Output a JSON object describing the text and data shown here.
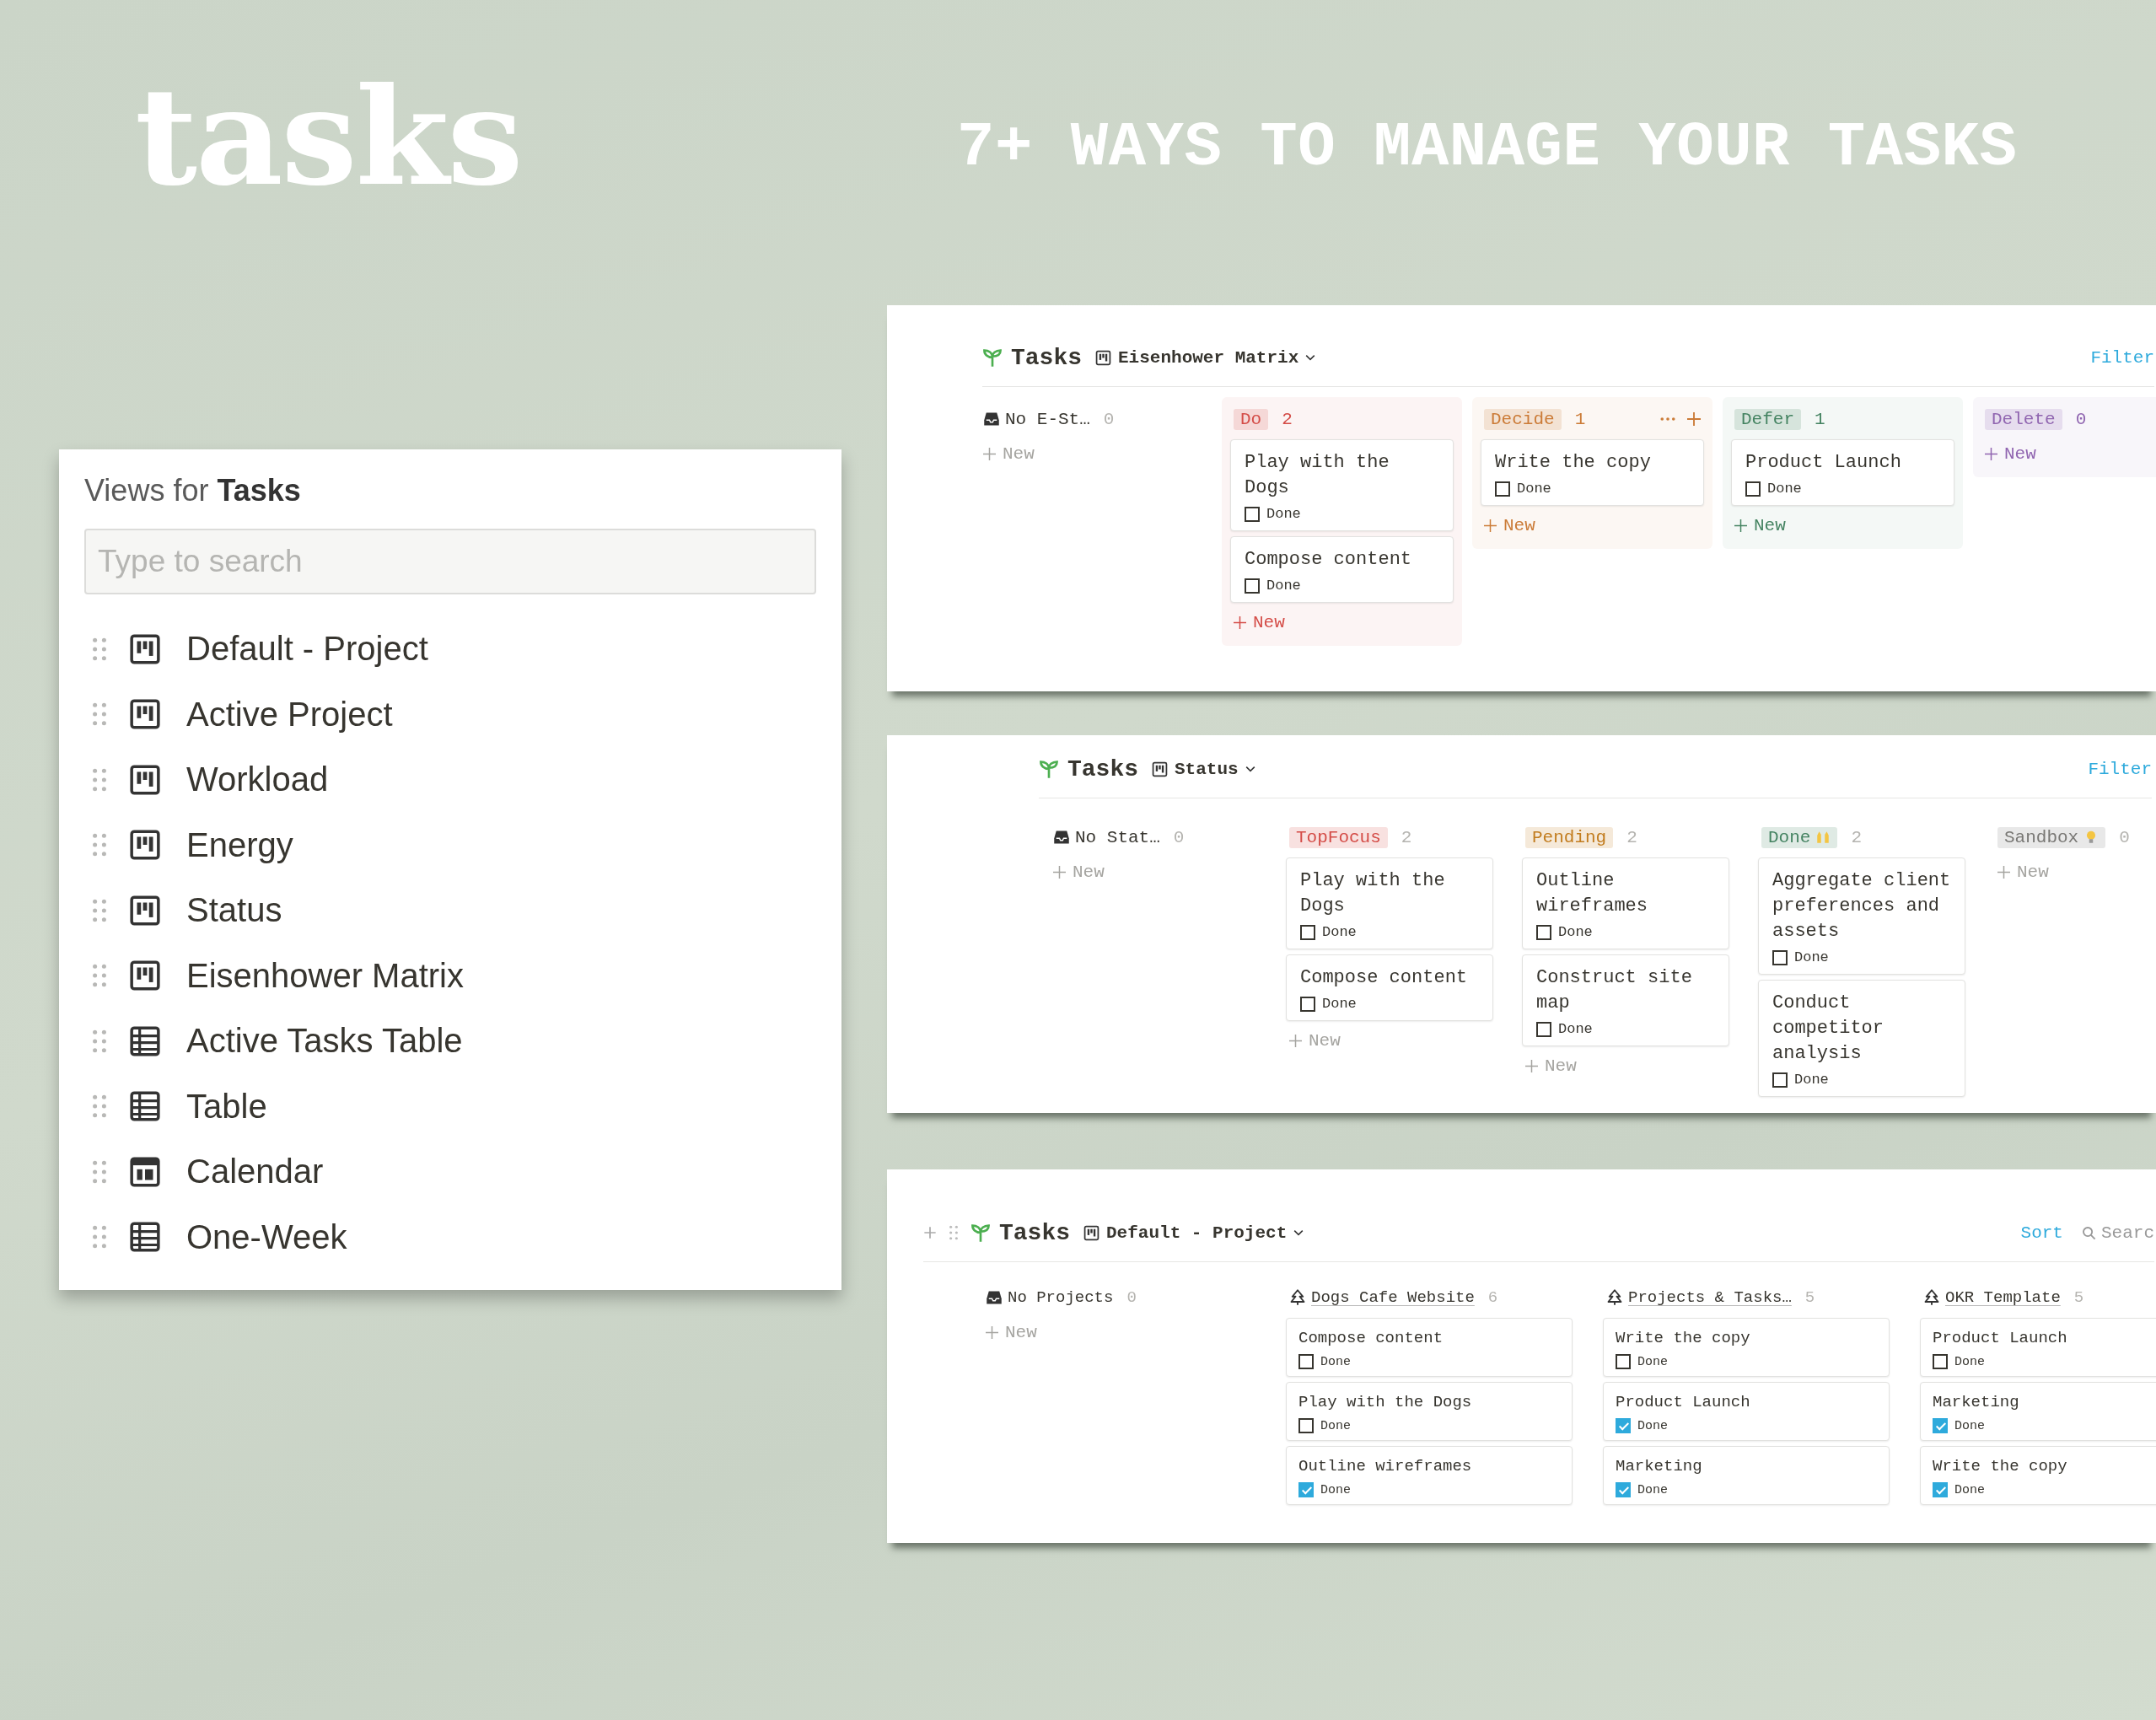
{
  "hero": {
    "title": "tasks",
    "tagline": "7+ WAYS TO MANAGE YOUR TASKS"
  },
  "views_panel": {
    "title": "Views for **Tasks**",
    "search": {
      "placeholder": "Type to search"
    },
    "items": [
      {
        "label": "Default - Project",
        "kind": "board"
      },
      {
        "label": "Active Project",
        "kind": "board"
      },
      {
        "label": "Workload",
        "kind": "board"
      },
      {
        "label": "Energy",
        "kind": "board"
      },
      {
        "label": "Status",
        "kind": "board"
      },
      {
        "label": "Eisenhower Matrix",
        "kind": "board"
      },
      {
        "label": "Active Tasks Table",
        "kind": "table"
      },
      {
        "label": "Table",
        "kind": "table"
      },
      {
        "label": "Calendar",
        "kind": "calendar"
      },
      {
        "label": "One-Week",
        "kind": "table"
      }
    ]
  },
  "boards": [
    {
      "database": "Tasks",
      "view": "Eisenhower Matrix",
      "tinted": true,
      "row_handles": false,
      "actions": [
        {
          "label": "Filter",
          "kind": "link"
        }
      ],
      "columns": [
        {
          "kind": "none",
          "name": "No E-St…",
          "count": "0",
          "new_label": "New"
        },
        {
          "kind": "tag",
          "name": "Do",
          "color": "#d44c47",
          "count": "2",
          "new_label": "New",
          "cards": [
            {
              "title": "Play with the Dogs",
              "field": "Done",
              "checked": false
            },
            {
              "title": "Compose content",
              "field": "Done",
              "checked": false
            }
          ]
        },
        {
          "kind": "tag",
          "name": "Decide",
          "color": "#cb7b37",
          "count": "1",
          "hover_actions": true,
          "new_label": "New",
          "cards": [
            {
              "title": "Write the copy",
              "field": "Done",
              "checked": false
            }
          ]
        },
        {
          "kind": "tag",
          "name": "Defer",
          "color": "#448361",
          "count": "1",
          "new_label": "New",
          "cards": [
            {
              "title": "Product Launch",
              "field": "Done",
              "checked": false
            }
          ]
        },
        {
          "kind": "tag",
          "name": "Delete",
          "color": "#9065b0",
          "count": "0",
          "new_label": "New"
        }
      ]
    },
    {
      "database": "Tasks",
      "view": "Status",
      "tinted": false,
      "row_handles": false,
      "actions": [
        {
          "label": "Filter",
          "kind": "link"
        }
      ],
      "columns": [
        {
          "kind": "none",
          "name": "No Stat…",
          "count": "0",
          "new_label": "New"
        },
        {
          "kind": "tag",
          "name": "TopFocus",
          "color": "#d44c47",
          "count": "2",
          "new_label": "New",
          "cards": [
            {
              "title": "Play with the Dogs",
              "field": "Done",
              "checked": false
            },
            {
              "title": "Compose content",
              "field": "Done",
              "checked": false
            }
          ]
        },
        {
          "kind": "tag",
          "name": "Pending",
          "color": "#c27c1e",
          "count": "2",
          "new_label": "New",
          "cards": [
            {
              "title": "Outline wireframes",
              "field": "Done",
              "checked": false
            },
            {
              "title": "Construct site map",
              "field": "Done",
              "checked": false
            }
          ]
        },
        {
          "kind": "tag",
          "name": "Done",
          "color": "#448361",
          "hands_icon": true,
          "count": "2",
          "cards": [
            {
              "title": "Aggregate client preferences and assets",
              "field": "Done",
              "checked": false
            },
            {
              "title": "Conduct competitor analysis",
              "field": "Done",
              "checked": false
            }
          ]
        },
        {
          "kind": "tag",
          "name": "Sandbox",
          "color": "#787774",
          "bulb_icon": true,
          "count": "0",
          "new_label": "New"
        }
      ]
    },
    {
      "database": "Tasks",
      "view": "Default - Project",
      "tinted": false,
      "row_handles": true,
      "actions": [
        {
          "label": "Sort",
          "kind": "link"
        },
        {
          "label": "Searc",
          "kind": "search"
        }
      ],
      "columns": [
        {
          "kind": "none",
          "name": "No Projects",
          "count": "0",
          "new_label": "New"
        },
        {
          "kind": "project",
          "name": "Dogs Cafe Website",
          "count": "6",
          "cards": [
            {
              "title": "Compose content",
              "field": "Done",
              "checked": false
            },
            {
              "title": "Play with the Dogs",
              "field": "Done",
              "checked": false
            },
            {
              "title": "Outline wireframes",
              "field": "Done",
              "checked": true
            }
          ]
        },
        {
          "kind": "project",
          "name": "Projects & Tasks…",
          "count": "5",
          "cards": [
            {
              "title": "Write the copy",
              "field": "Done",
              "checked": false
            },
            {
              "title": "Product Launch",
              "field": "Done",
              "checked": true
            },
            {
              "title": "Marketing",
              "field": "Done",
              "checked": true
            }
          ]
        },
        {
          "kind": "project",
          "name": "OKR Template",
          "count": "5",
          "cards": [
            {
              "title": "Product Launch",
              "field": "Done",
              "checked": false
            },
            {
              "title": "Marketing",
              "field": "Done",
              "checked": true
            },
            {
              "title": "Write the copy",
              "field": "Done",
              "checked": true
            }
          ]
        }
      ]
    }
  ]
}
